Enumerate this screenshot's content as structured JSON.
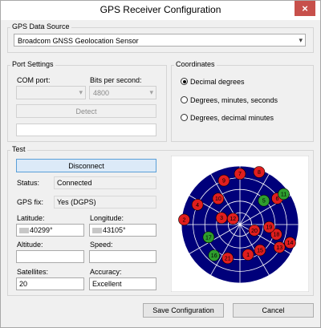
{
  "window": {
    "title": "GPS Receiver Configuration",
    "close_glyph": "×"
  },
  "data_source": {
    "group_label": "GPS Data Source",
    "selected": "Broadcom GNSS Geolocation Sensor"
  },
  "port_settings": {
    "group_label": "Port Settings",
    "com_port_label": "COM port:",
    "com_port_value": "",
    "bits_label": "Bits per second:",
    "bits_value": "4800",
    "detect_label": "Detect",
    "status_value": ""
  },
  "coordinates": {
    "group_label": "Coordinates",
    "options": [
      "Decimal degrees",
      "Degrees, minutes, seconds",
      "Degrees, decimal minutes"
    ],
    "selected_index": 0
  },
  "test": {
    "group_label": "Test",
    "disconnect_label": "Disconnect",
    "status_label": "Status:",
    "status_value": "Connected",
    "fix_label": "GPS fix:",
    "fix_value": "Yes (DGPS)",
    "latitude_label": "Latitude:",
    "latitude_value": "40299°",
    "longitude_label": "Longitude:",
    "longitude_value": "43105°",
    "altitude_label": "Altitude:",
    "altitude_value": "",
    "speed_label": "Speed:",
    "speed_value": "",
    "satellites_label": "Satellites:",
    "satellites_value": "20",
    "accuracy_label": "Accuracy:",
    "accuracy_value": "Excellent"
  },
  "skyplot": {
    "colors": {
      "background": "#00007a",
      "grid": "#ffffff",
      "in_use": "#2e9e2e",
      "not_in_use": "#e01e1e"
    },
    "satellites": [
      {
        "prn": "6",
        "azimuth": 55,
        "elevation": 20,
        "in_use": false
      },
      {
        "prn": "9",
        "azimuth": 340,
        "elevation": 18,
        "in_use": false
      },
      {
        "prn": "7",
        "azimuth": 0,
        "elevation": 12,
        "in_use": false
      },
      {
        "prn": "8",
        "azimuth": 20,
        "elevation": 4,
        "in_use": false
      },
      {
        "prn": "5",
        "azimuth": 45,
        "elevation": 38,
        "in_use": true
      },
      {
        "prn": "11",
        "azimuth": 55,
        "elevation": 8,
        "in_use": true
      },
      {
        "prn": "10",
        "azimuth": 320,
        "elevation": 38,
        "in_use": false
      },
      {
        "prn": "4",
        "azimuth": 295,
        "elevation": 18,
        "in_use": false
      },
      {
        "prn": "2",
        "azimuth": 275,
        "elevation": 4,
        "in_use": false
      },
      {
        "prn": "3",
        "azimuth": 290,
        "elevation": 60,
        "in_use": false
      },
      {
        "prn": "12",
        "azimuth": 310,
        "elevation": 76,
        "in_use": false
      },
      {
        "prn": "17",
        "azimuth": 248,
        "elevation": 38,
        "in_use": true
      },
      {
        "prn": "16",
        "azimuth": 220,
        "elevation": 28,
        "in_use": true
      },
      {
        "prn": "20",
        "azimuth": 112,
        "elevation": 66,
        "in_use": false
      },
      {
        "prn": "18",
        "azimuth": 105,
        "elevation": 32,
        "in_use": false
      },
      {
        "prn": "19",
        "azimuth": 95,
        "elevation": 45,
        "in_use": false
      },
      {
        "prn": "14",
        "azimuth": 110,
        "elevation": 8,
        "in_use": false
      },
      {
        "prn": "13",
        "azimuth": 120,
        "elevation": 20,
        "in_use": false
      },
      {
        "prn": "15",
        "azimuth": 142,
        "elevation": 40,
        "in_use": false
      },
      {
        "prn": "1",
        "azimuth": 165,
        "elevation": 42,
        "in_use": false
      },
      {
        "prn": "21",
        "azimuth": 200,
        "elevation": 35,
        "in_use": false
      }
    ]
  },
  "footer": {
    "save_label": "Save Configuration",
    "cancel_label": "Cancel"
  }
}
